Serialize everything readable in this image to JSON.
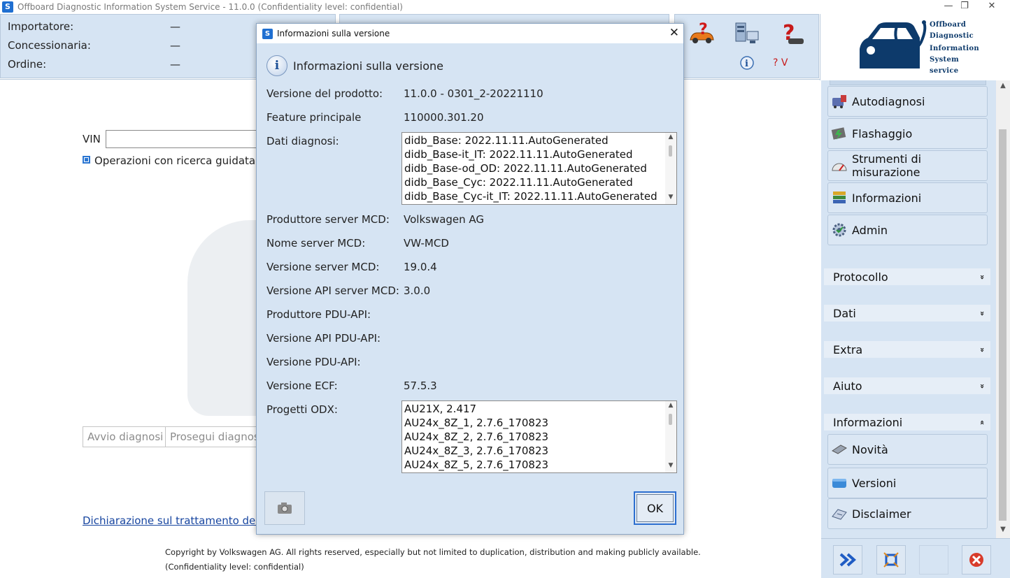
{
  "window": {
    "title": "Offboard Diagnostic Information System Service - 11.0.0 (Confidentiality level: confidential)",
    "app_icon": "S",
    "minimize": "—",
    "restore": "❐",
    "close": "✕"
  },
  "header": {
    "importer_label": "Importatore:",
    "importer_value": "—",
    "dealer_label": "Concessionaria:",
    "dealer_value": "—",
    "order_label": "Ordine:",
    "order_value": "—",
    "version_label": "? V"
  },
  "logo": {
    "line1": "Offboard",
    "line2": "Diagnostic",
    "line3": "Information",
    "line4": "System",
    "line5": "service"
  },
  "main": {
    "vin_label": "VIN",
    "guided_label": "Operazioni con ricerca guidata de",
    "start_button": "Avvio diagnosi",
    "continue_button": "Prosegui diagnosi",
    "privacy_link": "Dichiarazione sul trattamento dei da",
    "copyright_line1": "Copyright by Volkswagen AG. All rights reserved, especially but not limited to duplication, distribution and making publicly available.",
    "copyright_line2": "(Confidentiality level: confidential)"
  },
  "sidebar": {
    "buttons": [
      {
        "label": "Autodiagnosi",
        "icon": "car-diagnosis-icon"
      },
      {
        "label": "Flashaggio",
        "icon": "flash-icon"
      },
      {
        "label": "Strumenti di misurazione",
        "icon": "gauge-icon"
      },
      {
        "label": "Informazioni",
        "icon": "books-icon"
      },
      {
        "label": "Admin",
        "icon": "admin-gear-icon"
      }
    ],
    "sections": [
      {
        "label": "Protocollo",
        "chevron": "»"
      },
      {
        "label": "Dati",
        "chevron": "»"
      },
      {
        "label": "Extra",
        "chevron": "»"
      },
      {
        "label": "Aiuto",
        "chevron": "»"
      },
      {
        "label": "Informazioni",
        "chevron": "«"
      }
    ],
    "info_buttons": [
      {
        "label": "Novità",
        "icon": "news-icon"
      },
      {
        "label": "Versioni",
        "icon": "versions-icon"
      },
      {
        "label": "Disclaimer",
        "icon": "disclaimer-icon"
      }
    ]
  },
  "dialog": {
    "title": "Informazioni sulla versione",
    "heading": "Informazioni sulla versione",
    "close": "✕",
    "fields": {
      "product_version_label": "Versione del prodotto:",
      "product_version_value": "11.0.0  -  0301_2-20221110",
      "main_feature_label": "Feature principale",
      "main_feature_value": "110000.301.20",
      "diag_data_label": "Dati diagnosi:",
      "mcd_producer_label": "Produttore server MCD:",
      "mcd_producer_value": "Volkswagen AG",
      "mcd_name_label": "Nome server MCD:",
      "mcd_name_value": "VW-MCD",
      "mcd_version_label": "Versione server MCD:",
      "mcd_version_value": "19.0.4",
      "mcd_api_label": "Versione API server MCD:",
      "mcd_api_value": "3.0.0",
      "pdu_producer_label": "Produttore PDU-API:",
      "pdu_api_version_label": "Versione API PDU-API:",
      "pdu_version_label": "Versione PDU-API:",
      "ecf_version_label": "Versione ECF:",
      "ecf_version_value": "57.5.3",
      "odx_label": "Progetti ODX:"
    },
    "diag_data_items": [
      "didb_Base: 2022.11.11.AutoGenerated",
      "didb_Base-it_IT: 2022.11.11.AutoGenerated",
      "didb_Base-od_OD: 2022.11.11.AutoGenerated",
      "didb_Base_Cyc: 2022.11.11.AutoGenerated",
      "didb_Base_Cyc-it_IT: 2022.11.11.AutoGenerated"
    ],
    "odx_items": [
      "AU21X, 2.417",
      "AU24x_8Z_1, 2.7.6_170823",
      "AU24x_8Z_2, 2.7.6_170823",
      "AU24x_8Z_3, 2.7.6_170823",
      "AU24x_8Z_5, 2.7.6_170823"
    ],
    "ok_button": "OK"
  },
  "colors": {
    "panel_bg": "#d6e4f3",
    "accent_blue": "#2d6fd0",
    "link": "#1846a0",
    "logo_navy": "#0d3a6b"
  }
}
